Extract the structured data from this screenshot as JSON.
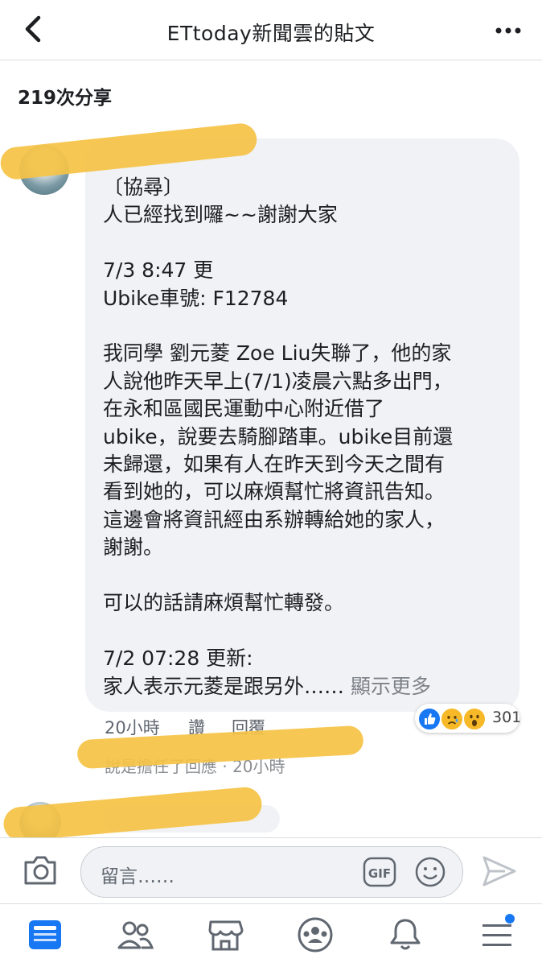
{
  "header": {
    "title": "ETtoday新聞雲的貼文",
    "back_icon": "chevron-left-icon",
    "more_icon": "more-dots-icon"
  },
  "shares": {
    "label": "219次分享"
  },
  "comment": {
    "lines": [
      "〔協尋〕",
      "人已經找到囉~~謝謝大家",
      "",
      "7/3 8:47 更",
      "Ubike車號: F12784",
      "",
      "我同學 劉元菱 Zoe Liu失聯了，他的家",
      "人說他昨天早上(7/1)凌晨六點多出門，",
      "在永和區國民運動中心附近借了",
      "ubike，說要去騎腳踏車。ubike目前還",
      "未歸還，如果有人在昨天到今天之間有",
      "看到她的，可以麻煩幫忙將資訊告知。",
      "這邊會將資訊經由系辦轉給她的家人，",
      "謝謝。",
      "",
      "可以的話請麻煩幫忙轉發。",
      "",
      "7/2 07:28 更新:"
    ],
    "last_line": "家人表示元菱是跟另外……",
    "see_more": "顯示更多",
    "time": "20小時",
    "like_label": "讚",
    "reply_label": "回覆",
    "reactions": {
      "count": "301",
      "types": [
        "like",
        "sad",
        "wow"
      ]
    },
    "reply_preview": "說是擔任了回應 · 20小時"
  },
  "comment_bar": {
    "placeholder": "留言……",
    "gif_label": "GIF"
  },
  "bottom_nav": {
    "items": [
      "news-feed-icon",
      "friends-icon",
      "marketplace-icon",
      "groups-icon",
      "notifications-icon",
      "menu-icon"
    ],
    "active": "news-feed-icon",
    "accent": "#1877f2"
  },
  "colors": {
    "scribble": "#f5c244",
    "bubble": "#f0f2f5",
    "like_blue": "#1877f2"
  }
}
